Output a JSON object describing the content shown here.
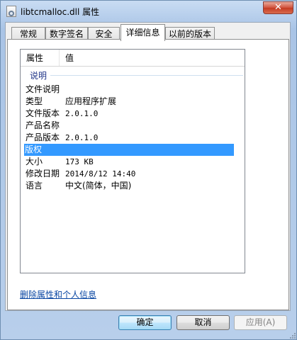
{
  "window": {
    "title": "libtcmalloc.dll 属性"
  },
  "tabs": [
    {
      "label": "常规",
      "active": false
    },
    {
      "label": "数字签名",
      "active": false
    },
    {
      "label": "安全",
      "active": false
    },
    {
      "label": "详细信息",
      "active": true
    },
    {
      "label": "以前的版本",
      "active": false
    }
  ],
  "details": {
    "header": {
      "property": "属性",
      "value": "值"
    },
    "group": "说明",
    "rows": [
      {
        "key": "文件说明",
        "value": ""
      },
      {
        "key": "类型",
        "value": "应用程序扩展"
      },
      {
        "key": "文件版本",
        "value": "2.0.1.0"
      },
      {
        "key": "产品名称",
        "value": ""
      },
      {
        "key": "产品版本",
        "value": "2.0.1.0"
      },
      {
        "key": "版权",
        "value": "",
        "selected": true
      },
      {
        "key": "大小",
        "value": "173 KB"
      },
      {
        "key": "修改日期",
        "value": "2014/8/12 14:40"
      },
      {
        "key": "语言",
        "value": "中文(简体，中国)"
      }
    ]
  },
  "remove_link": "删除属性和个人信息",
  "buttons": {
    "ok": "确定",
    "cancel": "取消",
    "apply": "应用(A)"
  },
  "colors": {
    "selection": "#3399ff",
    "link": "#0a47a3",
    "close_button": "#c43b22"
  }
}
